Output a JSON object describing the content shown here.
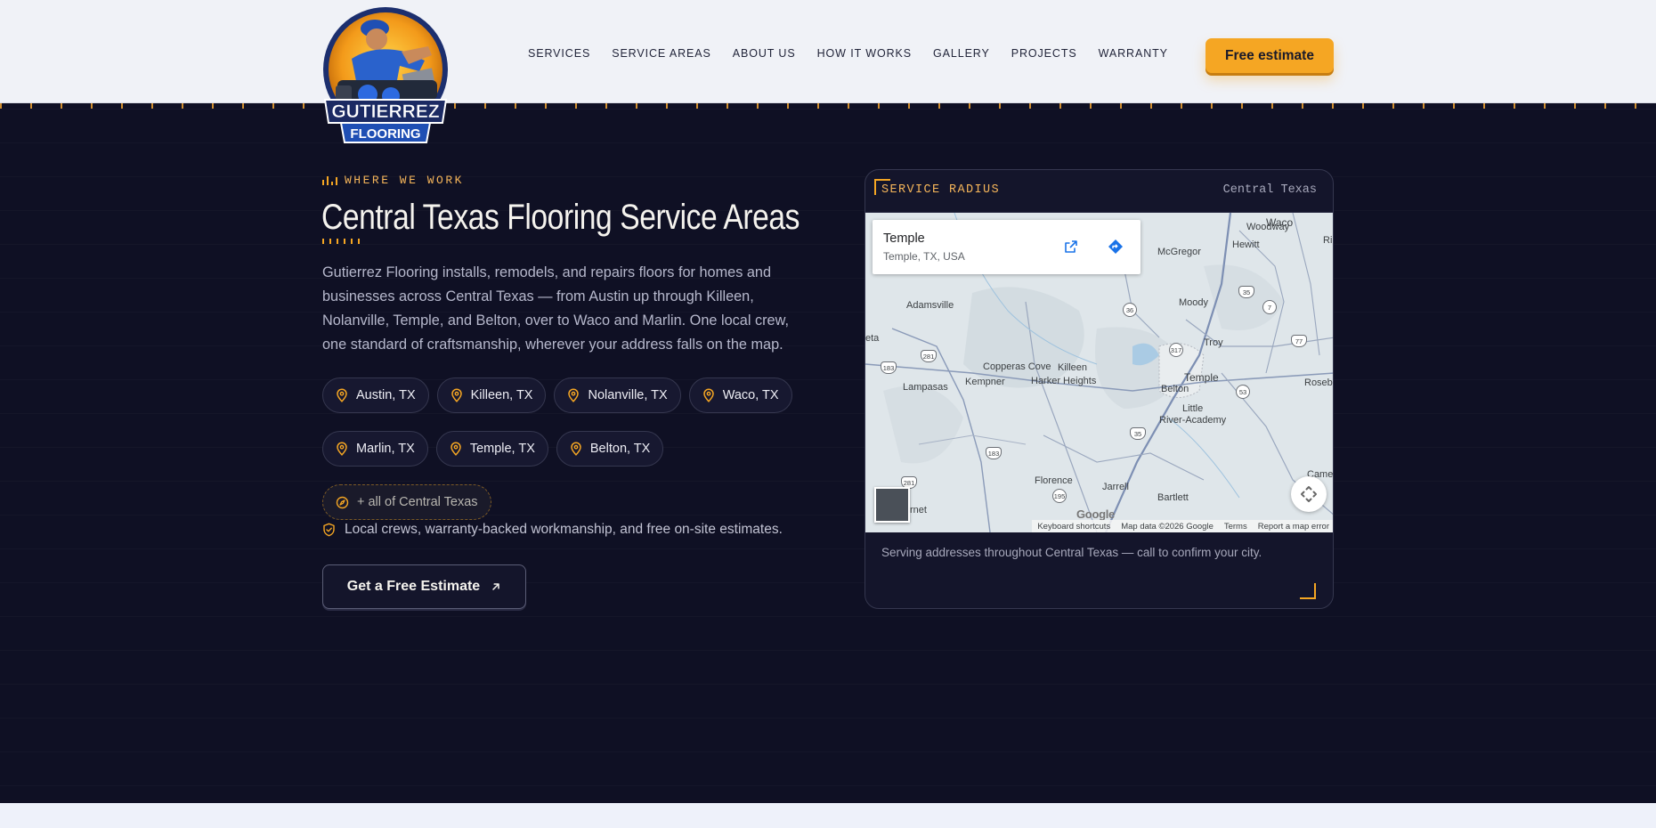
{
  "brand": {
    "logo_line1": "GUTIERREZ",
    "logo_line2": "FLOORING",
    "colors": {
      "accent": "#f5a623",
      "dark_bg": "#0f1024",
      "header_bg": "#f0f2f7"
    }
  },
  "nav": {
    "items": [
      "SERVICES",
      "SERVICE AREAS",
      "ABOUT US",
      "HOW IT WORKS",
      "GALLERY",
      "PROJECTS",
      "WARRANTY"
    ],
    "cta_label": "Free estimate"
  },
  "hero": {
    "eyebrow": "WHERE WE WORK",
    "title": "Central Texas Flooring Service Areas",
    "description": "Gutierrez Flooring installs, remodels, and repairs floors for homes and businesses across Central Texas — from Austin up through Killeen, Nolanville, Temple, and Belton, over to Waco and Marlin. One local crew, one standard of craftsmanship, wherever your address falls on the map.",
    "areas": [
      "Austin, TX",
      "Killeen, TX",
      "Nolanville, TX",
      "Waco, TX",
      "Marlin, TX",
      "Temple, TX",
      "Belton, TX"
    ],
    "extra_area": "+ all of Central Texas",
    "note": "Local crews, warranty-backed workmanship, and free on-site estimates.",
    "cta_label": "Get a Free Estimate",
    "icons": {
      "area": "map-pin-icon",
      "extra": "compass-icon",
      "note": "shield-check-icon",
      "cta": "arrow-up-right-icon"
    }
  },
  "map_card": {
    "title": "SERVICE RADIUS",
    "region": "Central Texas",
    "footer": "Serving addresses throughout Central Texas — call to confirm your city.",
    "place": {
      "name": "Temple",
      "address": "Temple, TX, USA"
    },
    "labels": {
      "waco": "Waco",
      "woodway": "Woodway",
      "hewitt": "Hewitt",
      "mcgregor": "McGregor",
      "ri": "Ri",
      "moody": "Moody",
      "adamsville": "Adamsville",
      "troy": "Troy",
      "eta": "eta",
      "rosebud": "Rosebu",
      "copperas": "Copperas Cove",
      "killeen": "Killeen",
      "kempner": "Kempner",
      "harker": "Harker Heights",
      "lampasas": "Lampasas",
      "belton": "Belton",
      "temple": "Temple",
      "little_river": "Little",
      "little_river2": "River-Academy",
      "florence": "Florence",
      "jarrell": "Jarrell",
      "bartlett": "Bartlett",
      "burnet": "rnet",
      "camero": "Camero"
    },
    "shields": {
      "i35a": "35",
      "s7": "7",
      "s36": "36",
      "s317": "317",
      "u77": "77",
      "u183a": "183",
      "u281a": "281",
      "s53": "53",
      "i35b": "35",
      "u183b": "183",
      "u281b": "281",
      "s195": "195"
    },
    "google": "Google",
    "attribution": [
      "Keyboard shortcuts",
      "Map data ©2026 Google",
      "Terms",
      "Report a map error"
    ]
  }
}
